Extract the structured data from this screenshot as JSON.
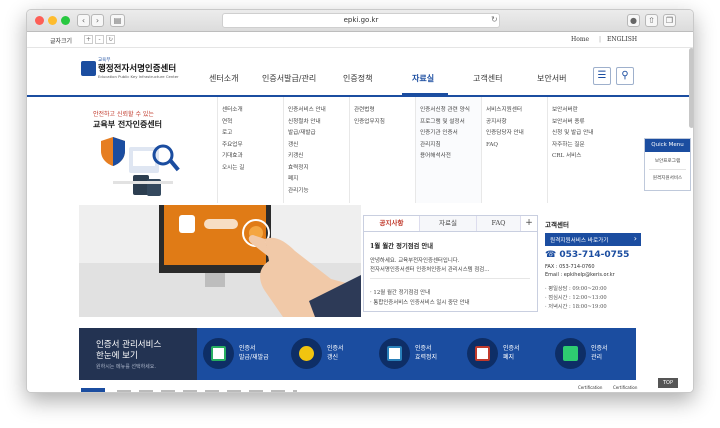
{
  "browser": {
    "url": "epki.go.kr"
  },
  "topbar": {
    "font_label": "글자크기",
    "plus": "+",
    "minus": "-",
    "home": "Home",
    "english": "ENGLISH"
  },
  "logo": {
    "small": "교육부",
    "main": "행정전자서명인증센터",
    "sub": "Education Public Key Infrastructure Center"
  },
  "nav": [
    "센터소개",
    "인증서발급/관리",
    "인증정책",
    "자료실",
    "고객센터",
    "보안서버"
  ],
  "mega": {
    "intro1": "안전하고 신뢰할 수 있는",
    "intro2": "교육부 전자인증센터",
    "columns": [
      [
        "센터소개",
        "연혁",
        "로고",
        "주요업무",
        "기대효과",
        "오시는 길"
      ],
      [
        "인증서비스 안내",
        "신청절차 안내",
        "발급/재발급",
        "갱신",
        "키갱신",
        "효력정지",
        "폐지",
        "관리기능"
      ],
      [
        "관련법령",
        "인증업무지침"
      ],
      [
        "인증서신청 관련 양식",
        "프로그램 및 설정서",
        "인증기관 인증서",
        "관리지침",
        "용어해석사전"
      ],
      [
        "서비스지원센터",
        "공지사항",
        "인증담당자 안내",
        "FAQ"
      ],
      [
        "보안서버란",
        "보안서버 종류",
        "신청 및 발급 안내",
        "자주하는 질문",
        "CRL 서비스"
      ]
    ]
  },
  "tabs": {
    "labels": [
      "공지사항",
      "자료실",
      "FAQ",
      "+"
    ],
    "notice_title": "1월 월간 정기점검 안내",
    "notice_body1": "안녕하세요. 교육부전자인증센터입니다.",
    "notice_body2": "전자서명인증서센터 인증처인증서 관리시스템 점검...",
    "list1": "· 12월 월간 정기점검 안내",
    "list2": "· 통합인증서비스 인증서비스 일시 중단 안내"
  },
  "support": {
    "title": "고객센터",
    "remote_btn": "원격지원서비스 바로가기",
    "phone": "053-714-0755",
    "fax": "FAX : 053-714-0760",
    "email": "Email : epkihelp@keris.or.kr",
    "hours1": "· 평일상담 : 09:00~20:00",
    "hours2": "· 점심시간 : 12:00~13:00",
    "hours3": "· 저녁시간 : 18:00~19:00"
  },
  "service_strip": {
    "title1": "인증서 관리서비스",
    "title2": "한눈에 보기",
    "subtitle": "원하시는 메뉴를 선택하세요.",
    "items": [
      {
        "l1": "인증서",
        "l2": "발급/재발급"
      },
      {
        "l1": "인증서",
        "l2": "갱신"
      },
      {
        "l1": "인증서",
        "l2": "효력정지"
      },
      {
        "l1": "인증서",
        "l2": "폐지"
      },
      {
        "l1": "인증서",
        "l2": "관리"
      }
    ]
  },
  "quick_menu": {
    "title": "Quick Menu",
    "i1": "보안프로그램",
    "i2": "원격지원서비스"
  },
  "bottom": {
    "top_btn": "TOP",
    "cert1": "Certification",
    "cert2": "Certification"
  },
  "colors": {
    "brand": "#1b4da0",
    "dark": "#233352",
    "accent": "#c0392b"
  }
}
